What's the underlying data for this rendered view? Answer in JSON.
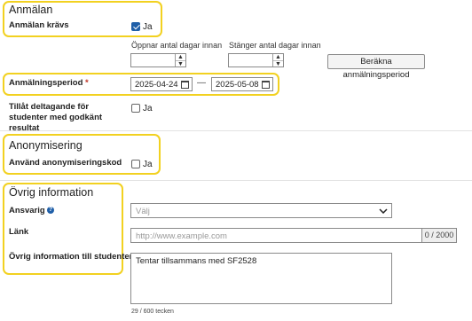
{
  "registration": {
    "title": "Anmälan",
    "required_label": "Anmälan krävs",
    "required_checked": true,
    "required_option": "Ja",
    "opens_label": "Öppnar antal dagar innan",
    "closes_label": "Stänger antal dagar innan",
    "opens_value": "",
    "closes_value": "",
    "calc_button": "Beräkna anmälningsperiod",
    "period_label": "Anmälningsperiod",
    "period_required_mark": "*",
    "period_start": "2025-04-24",
    "period_separator": "—",
    "period_end": "2025-05-08",
    "allow_passed_label": "Tillåt deltagande för studenter med godkänt resultat",
    "allow_passed_checked": false,
    "allow_passed_option": "Ja"
  },
  "anonymization": {
    "title": "Anonymisering",
    "use_code_label": "Använd anonymiseringskod",
    "use_code_checked": false,
    "use_code_option": "Ja"
  },
  "other": {
    "title": "Övrig information",
    "responsible_label": "Ansvarig",
    "responsible_placeholder": "Välj",
    "link_label": "Länk",
    "link_placeholder": "http://www.example.com",
    "link_counter": "0 / 2000",
    "info_label": "Övrig information till studenten",
    "info_value": "Tentar tillsammans med SF2528",
    "info_counter": "29 / 600 tecken"
  },
  "colors": {
    "highlight": "#f2d120",
    "accent": "#1f5fa8"
  },
  "icons": {
    "calendar": "calendar-icon",
    "help": "help-icon",
    "chevron": "chevron-down-icon"
  }
}
